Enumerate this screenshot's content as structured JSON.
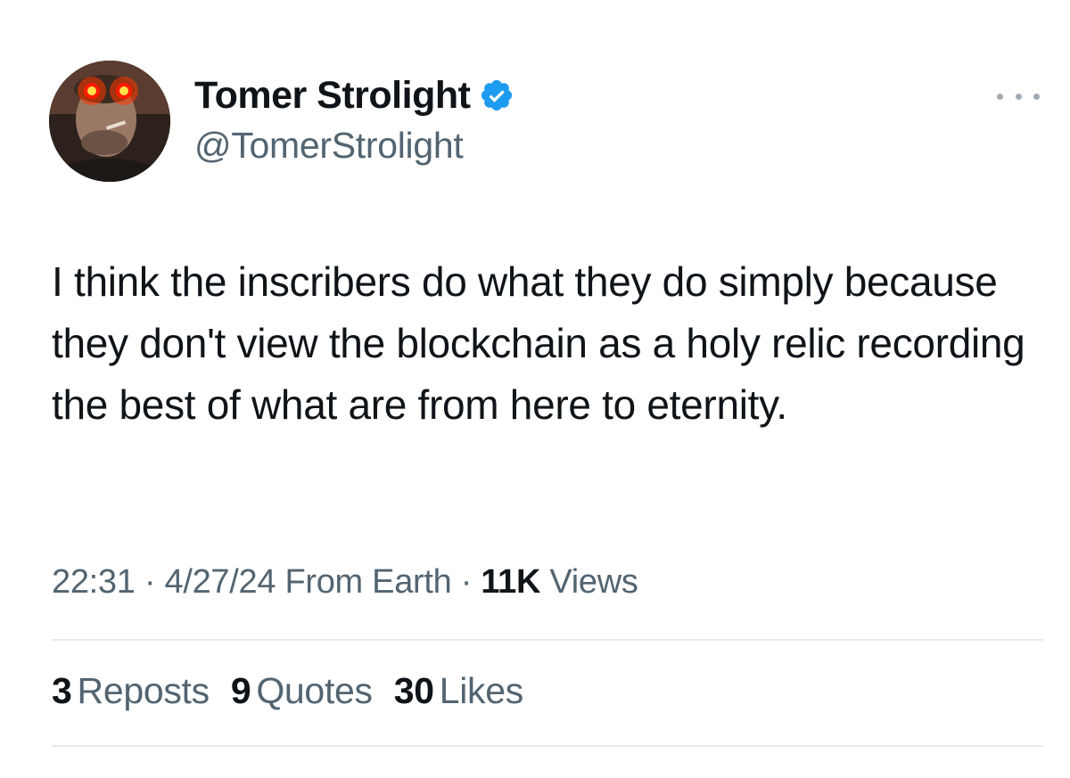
{
  "author": {
    "display_name": "Tomer Strolight",
    "handle": "@TomerStrolight",
    "verified_icon": "verified-badge-icon",
    "avatar_icon": "avatar-laser-eyes"
  },
  "tweet": {
    "text": "I think the inscribers do what they do simply because they don't view the blockchain as a holy relic recording the best of what are from here to eternity.",
    "time": "22:31",
    "date": "4/27/24",
    "location": "From Earth",
    "views_count": "11K",
    "views_label": "Views",
    "separator": "·"
  },
  "stats": {
    "reposts_count": "3",
    "reposts_label": "Reposts",
    "quotes_count": "9",
    "quotes_label": "Quotes",
    "likes_count": "30",
    "likes_label": "Likes"
  },
  "colors": {
    "verified_blue": "#1d9bf0",
    "secondary_text": "#536471",
    "primary_text": "#0f1419",
    "divider": "#e7eaec"
  }
}
